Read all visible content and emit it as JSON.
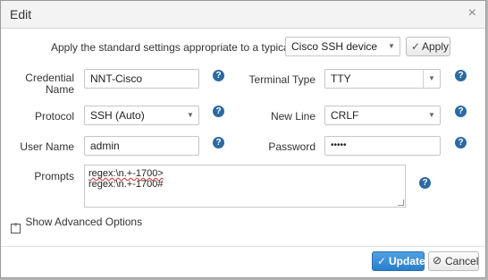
{
  "dialog": {
    "title": "Edit",
    "close_glyph": "×"
  },
  "top": {
    "apply_text": "Apply the standard settings appropriate to a typical",
    "device_select": "Cisco SSH device",
    "apply_button": "Apply"
  },
  "fields": {
    "credential_name": {
      "label_line1": "Credential",
      "label_line2": "Name",
      "value": "NNT-Cisco"
    },
    "terminal_type": {
      "label": "Terminal Type",
      "value": "TTY"
    },
    "protocol": {
      "label": "Protocol",
      "value": "SSH (Auto)"
    },
    "new_line": {
      "label": "New Line",
      "value": "CRLF"
    },
    "user_name": {
      "label": "User Name",
      "value": "admin"
    },
    "password": {
      "label": "Password",
      "value": "•••••"
    },
    "prompts": {
      "label": "Prompts",
      "line1": "regex:\\n.+-1700>",
      "line2": "regex:\\n.+-1700#"
    }
  },
  "advanced": {
    "label": "Show Advanced Options"
  },
  "footer": {
    "update_button": "Update",
    "cancel_button": "Cancel"
  },
  "colors": {
    "primary": "#2a7fcb",
    "help_icon": "#2c6aa0"
  },
  "icons": [
    "close-icon",
    "caret-down-icon",
    "check-icon",
    "help-icon",
    "list-icon",
    "ban-icon"
  ]
}
